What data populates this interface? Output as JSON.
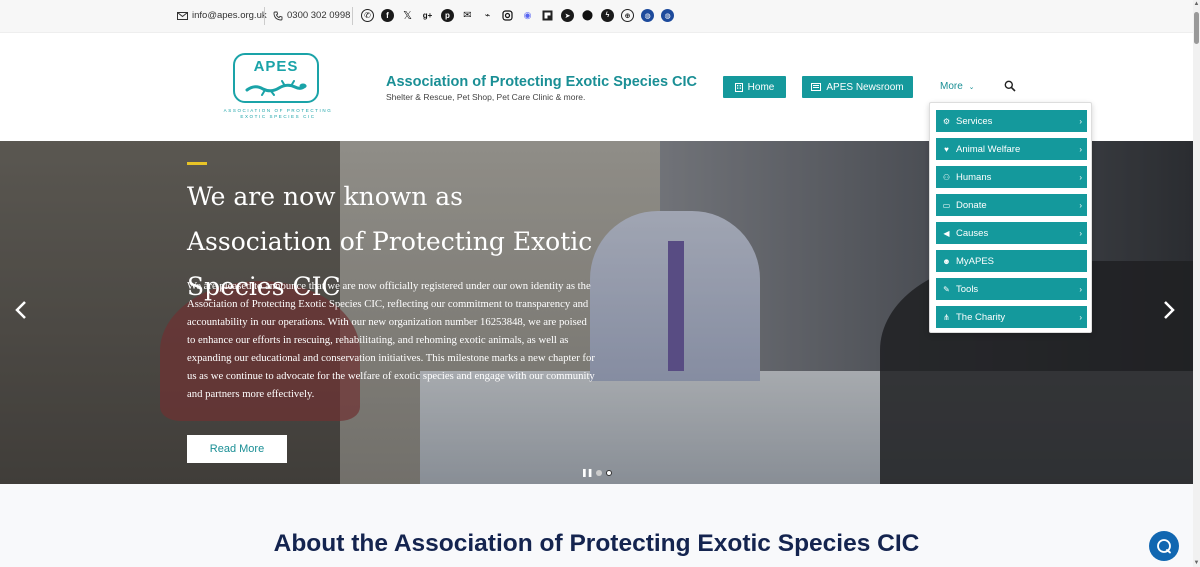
{
  "topbar": {
    "email": "info@apes.org.uk",
    "phone": "0300 302 0998",
    "social_icons": [
      "whatsapp-icon",
      "facebook-icon",
      "x-icon",
      "google-plus-icon",
      "pinterest-icon",
      "email-icon",
      "rss-icon",
      "instagram-icon",
      "discord-icon",
      "flipboard-icon",
      "telegram-icon",
      "location-icon",
      "messenger-icon",
      "web-icon",
      "globe-icon",
      "globe-icon-2"
    ]
  },
  "header": {
    "logo_text": "APES",
    "logo_tagline_1": "ASSOCIATION OF PROTECTING",
    "logo_tagline_2": "EXOTIC SPECIES CIC",
    "site_title": "Association of Protecting Exotic Species CIC",
    "site_subtitle": "Shelter & Rescue, Pet Shop, Pet Care Clinic & more.",
    "nav": {
      "home": "Home",
      "newsroom": "APES Newsroom",
      "more": "More"
    }
  },
  "dropdown": {
    "items": [
      {
        "label": "Services",
        "icon": "gear-icon",
        "has_submenu": true
      },
      {
        "label": "Animal Welfare",
        "icon": "heart-icon",
        "has_submenu": true
      },
      {
        "label": "Humans",
        "icon": "people-icon",
        "has_submenu": true
      },
      {
        "label": "Donate",
        "icon": "money-icon",
        "has_submenu": true
      },
      {
        "label": "Causes",
        "icon": "megaphone-icon",
        "has_submenu": true
      },
      {
        "label": "MyAPES",
        "icon": "user-plus-icon",
        "has_submenu": false
      },
      {
        "label": "Tools",
        "icon": "tools-icon",
        "has_submenu": true
      },
      {
        "label": "The Charity",
        "icon": "sitemap-icon",
        "has_submenu": true
      }
    ]
  },
  "hero": {
    "heading": "We are now known as Association of Protecting Exotic Species CIC",
    "body": "We are pleased to announce that we are now officially registered under our own identity as the Association of Protecting Exotic Species CIC, reflecting our commitment to transparency and accountability in our operations. With our new organization number 16253848, we are poised to enhance our efforts in rescuing, rehabilitating, and rehoming exotic animals, as well as expanding our educational and conservation initiatives. This milestone marks a new chapter for us as we continue to advocate for the welfare of exotic species and engage with our community and partners more effectively.",
    "button": "Read More",
    "prev": "‹",
    "next": "›",
    "slides": 2,
    "active_slide": 2
  },
  "about": {
    "heading": "About the Association of Protecting Exotic Species CIC"
  },
  "colors": {
    "teal": "#15999c",
    "navy": "#14244f",
    "accent": "#e8c427",
    "chat": "#1167b1"
  }
}
